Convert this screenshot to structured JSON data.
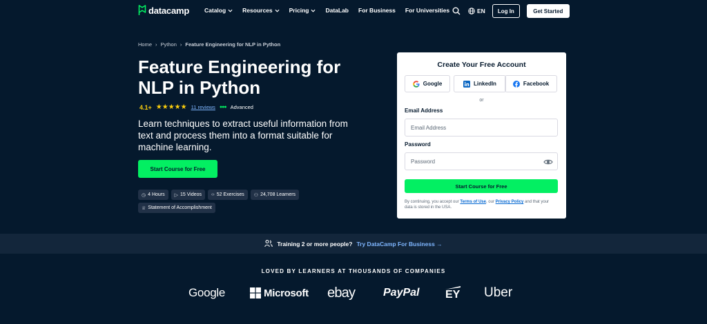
{
  "nav": {
    "brand": "datacamp",
    "links": [
      {
        "label": "Catalog",
        "dropdown": true
      },
      {
        "label": "Resources",
        "dropdown": true
      },
      {
        "label": "Pricing",
        "dropdown": true
      },
      {
        "label": "DataLab",
        "dropdown": false
      },
      {
        "label": "For Business",
        "dropdown": false
      },
      {
        "label": "For Universities",
        "dropdown": false
      }
    ],
    "language": "EN",
    "login": "Log In",
    "get_started": "Get Started"
  },
  "breadcrumb": {
    "home": "Home",
    "sep": "›",
    "section": "Python",
    "current": "Feature Engineering for NLP in Python"
  },
  "course": {
    "title": "Feature Engineering for NLP in Python",
    "rating": "4.1+",
    "stars": "★★★★★",
    "reviews": "11 reviews",
    "level": "Advanced",
    "description": "Learn techniques to extract useful information from text and process them into a format suitable for machine learning.",
    "cta": "Start Course for Free",
    "chips": [
      {
        "icon": "clock-icon",
        "label": "4 Hours"
      },
      {
        "icon": "play-icon",
        "label": "15 Videos"
      },
      {
        "icon": "code-icon",
        "label": "52 Exercises"
      },
      {
        "icon": "learners-icon",
        "label": "24,708 Learners"
      },
      {
        "icon": "trophy-icon",
        "label": "Statement of Accomplishment"
      }
    ]
  },
  "signup": {
    "title": "Create Your Free Account",
    "google": "Google",
    "linkedin": "LinkedIn",
    "facebook": "Facebook",
    "or": "or",
    "email_label": "Email Address",
    "email_placeholder": "Email Address",
    "password_label": "Password",
    "password_placeholder": "Password",
    "submit": "Start Course for Free",
    "legal_pre": "By continuing, you accept our ",
    "terms": "Terms of Use",
    "legal_mid": ", our ",
    "privacy": "Privacy Policy",
    "legal_post": " and that your data is stored in the USA."
  },
  "banner": {
    "text": "Training 2 or more people?",
    "link": "Try DataCamp For Business →"
  },
  "companies": {
    "heading": "LOVED BY LEARNERS AT THOUSANDS OF COMPANIES",
    "logos": [
      "Google",
      "Microsoft",
      "ebay",
      "PayPal",
      "EY",
      "Uber"
    ]
  },
  "colors": {
    "background": "#05192d",
    "accent_green": "#03ef62",
    "star_yellow": "#fcce0d",
    "link_blue": "#7fb6ff"
  }
}
